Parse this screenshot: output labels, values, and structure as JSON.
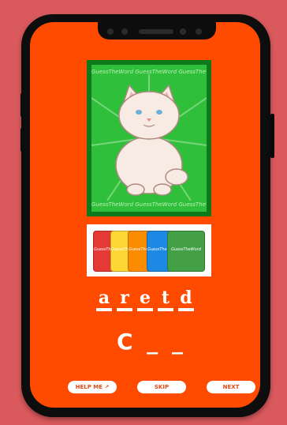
{
  "card": {
    "brand_text": "GuessTheWord GuessTheWord GuessTheWord",
    "image_subject": "fluffy-white-cat"
  },
  "deck": {
    "cards": [
      {
        "label": "GuessTheWord",
        "color": "#e53935"
      },
      {
        "label": "GuessTheWord",
        "color": "#fdd835"
      },
      {
        "label": "GuessTheWord",
        "color": "#fb8c00"
      },
      {
        "label": "GuessTheWord",
        "color": "#1e88e5"
      },
      {
        "label": "GuessTheWord",
        "color": "#43a047"
      }
    ]
  },
  "puzzle": {
    "scrambled": [
      "a",
      "r",
      "e",
      "t",
      "d"
    ],
    "answer": "C _ _"
  },
  "buttons": {
    "help": "HELP ME ↗",
    "skip": "SKIP",
    "next": "NEXT"
  },
  "colors": {
    "background": "#d9595c",
    "screen": "#ff4b00",
    "card_border": "#0e7a1c",
    "card_fill": "#2fbf3a"
  }
}
